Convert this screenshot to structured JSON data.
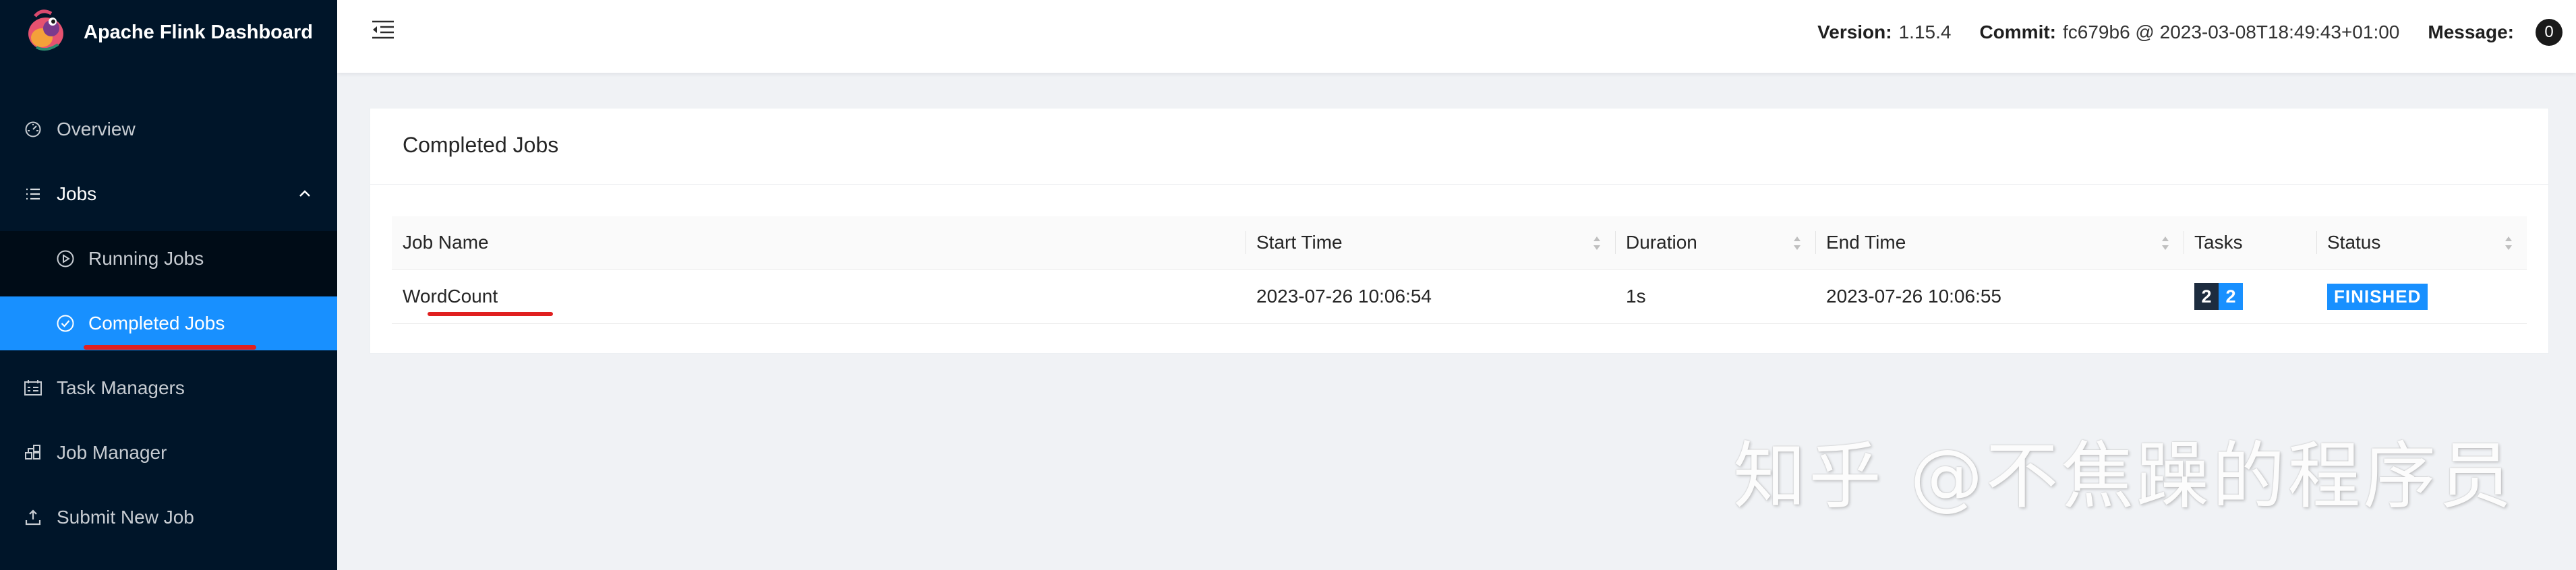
{
  "app": {
    "title": "Apache Flink Dashboard"
  },
  "sidebar": {
    "items": [
      {
        "label": "Overview",
        "icon": "dashboard-icon"
      },
      {
        "label": "Jobs",
        "icon": "list-icon"
      },
      {
        "label": "Running Jobs",
        "icon": "play-circle-icon"
      },
      {
        "label": "Completed Jobs",
        "icon": "check-circle-icon"
      },
      {
        "label": "Task Managers",
        "icon": "schedule-icon"
      },
      {
        "label": "Job Manager",
        "icon": "cluster-icon"
      },
      {
        "label": "Submit New Job",
        "icon": "upload-icon"
      }
    ]
  },
  "header": {
    "version_label": "Version:",
    "version_value": "1.15.4",
    "commit_label": "Commit:",
    "commit_value": "fc679b6 @ 2023-03-08T18:49:43+01:00",
    "message_label": "Message:",
    "message_count": "0"
  },
  "card": {
    "title": "Completed Jobs"
  },
  "table": {
    "columns": [
      "Job Name",
      "Start Time",
      "Duration",
      "End Time",
      "Tasks",
      "Status"
    ],
    "rows": [
      {
        "job_name": "WordCount",
        "start_time": "2023-07-26 10:06:54",
        "duration": "1s",
        "end_time": "2023-07-26 10:06:55",
        "tasks_total": "2",
        "tasks_finished": "2",
        "status": "FINISHED"
      }
    ]
  },
  "watermark": "知乎 @不焦躁的程序员",
  "colors": {
    "sidebar_bg": "#001529",
    "accent": "#1890ff",
    "annotation_red": "#e02020"
  }
}
